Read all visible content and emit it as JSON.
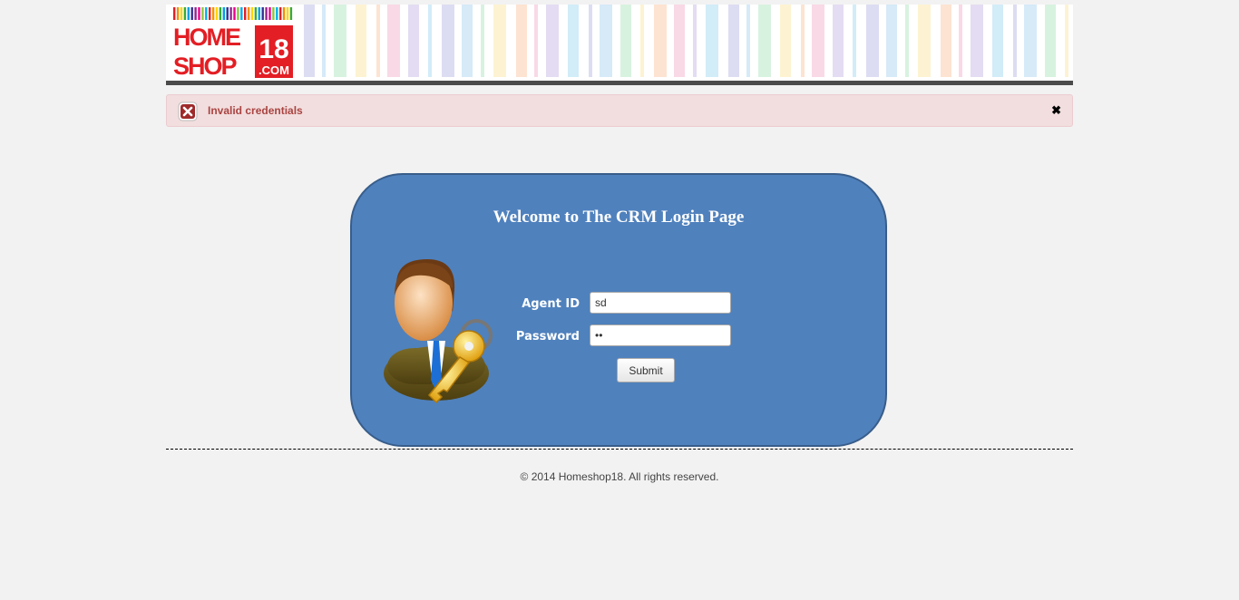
{
  "header": {
    "logo": {
      "line1": "HOME",
      "line2": "SHOP",
      "number": "18",
      "suffix": ".COM",
      "brand_color": "#e31e24"
    }
  },
  "alert": {
    "message": "Invalid credentials",
    "close_symbol": "✖",
    "icon": "error-x-icon",
    "bg_color": "#f2dede",
    "text_color": "#a94442"
  },
  "login": {
    "title": "Welcome to The CRM Login Page",
    "illustration": "user-with-key-icon",
    "agent_id_label": "Agent ID",
    "agent_id_value": "sd",
    "password_label": "Password",
    "password_value": "ab",
    "submit_label": "Submit",
    "panel_color": "#4f81bd"
  },
  "footer": {
    "copyright": "© 2014 Homeshop18. All rights reserved."
  }
}
